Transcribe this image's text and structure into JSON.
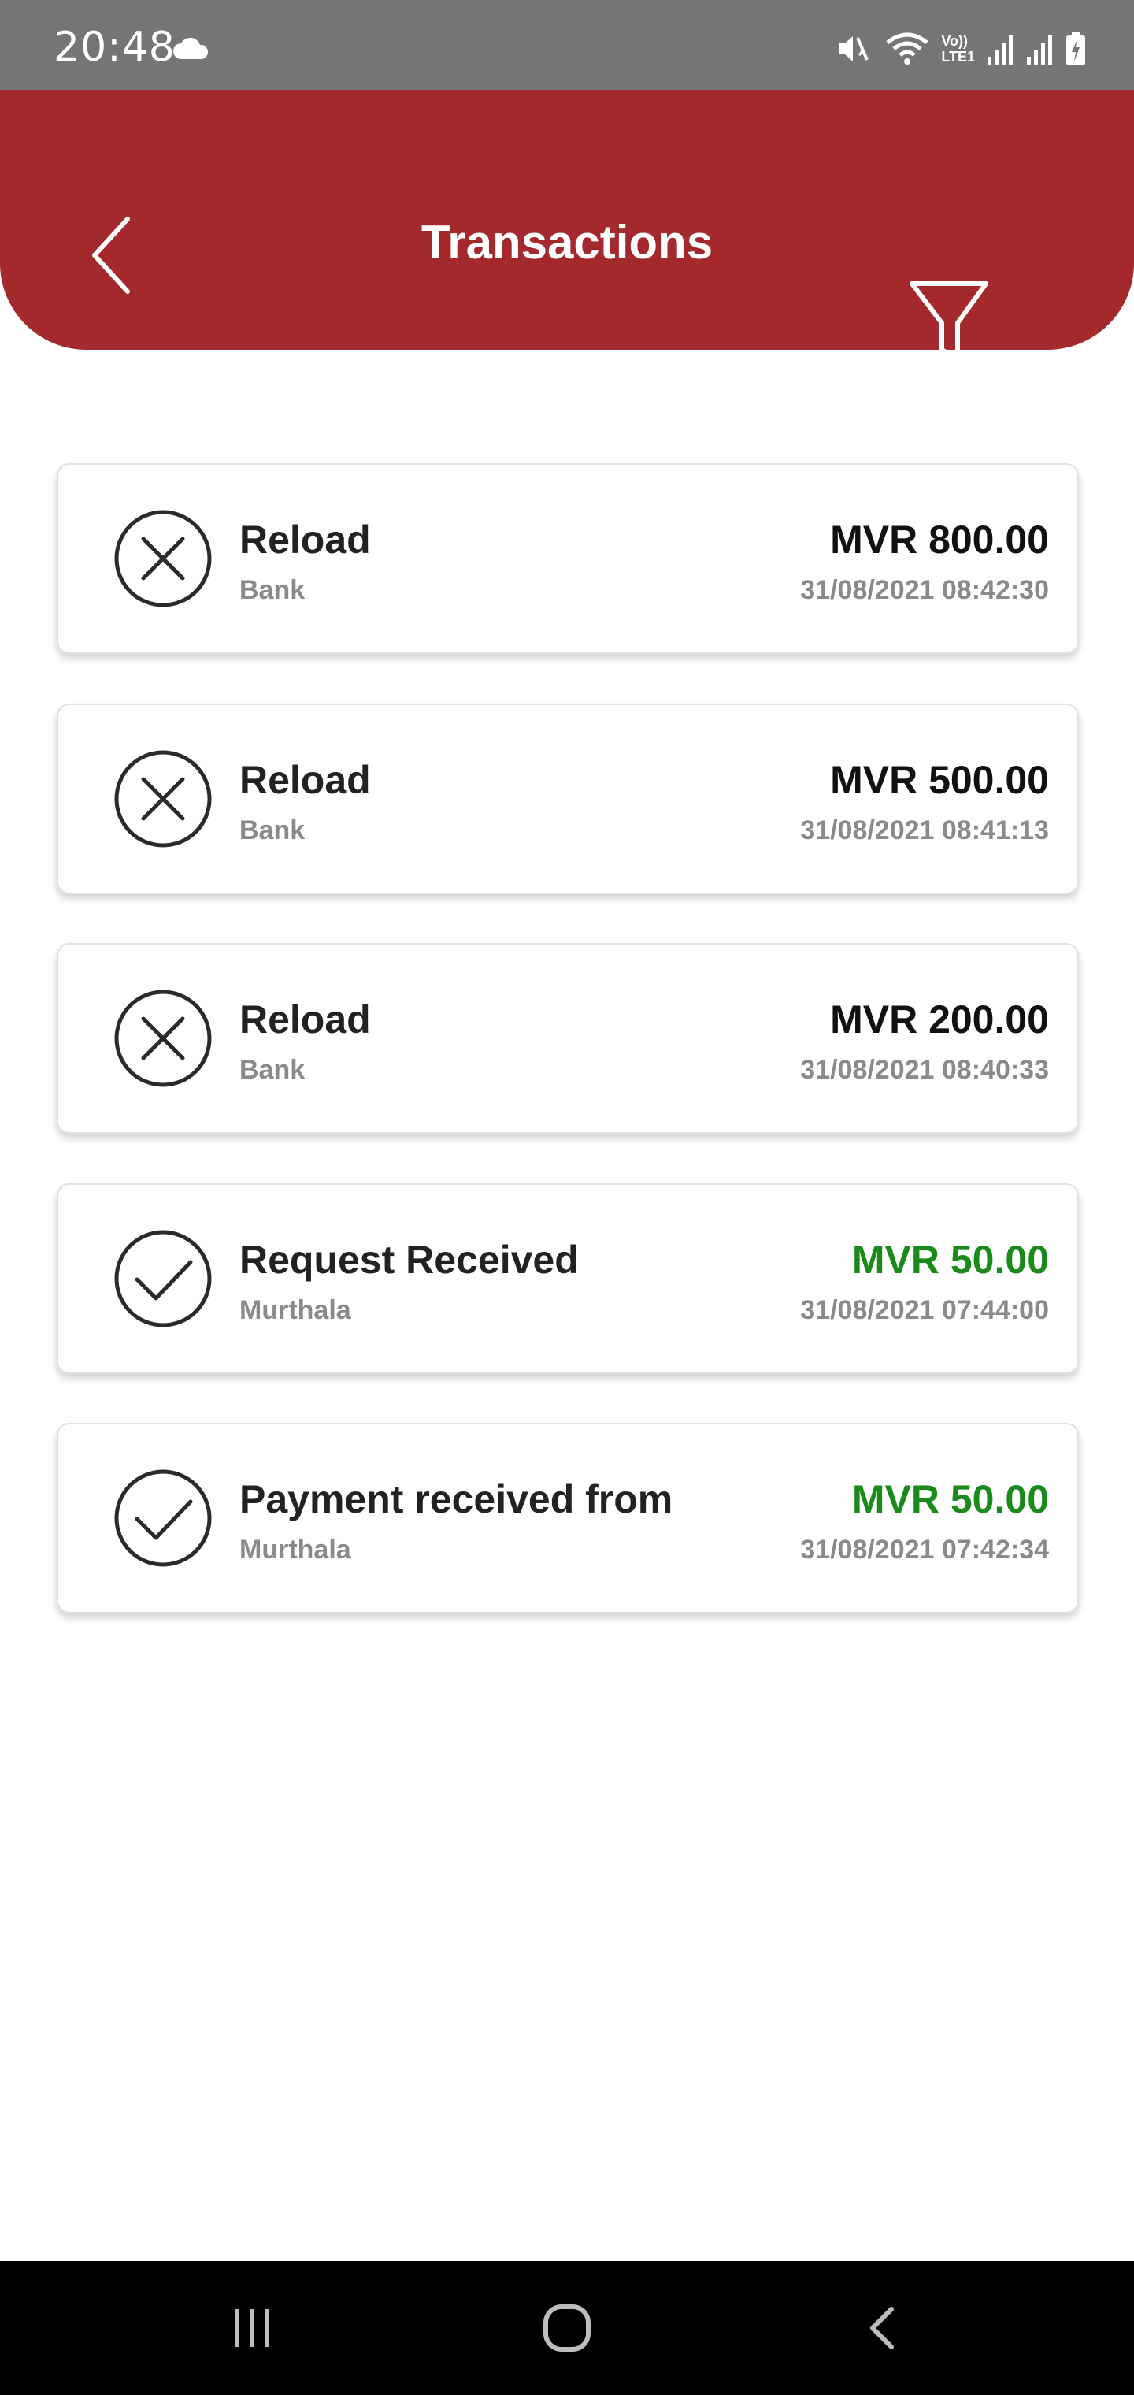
{
  "status_bar": {
    "time": "20:48",
    "icons": [
      "cloud-icon",
      "mute-icon",
      "wifi-icon",
      "volte-icon",
      "signal-icon",
      "signal-icon",
      "battery-icon"
    ],
    "volte_label_top": "Vo))",
    "volte_label_bottom": "LTE1"
  },
  "header": {
    "title": "Transactions",
    "back_icon": "back-arrow-icon",
    "filter_icon": "filter-icon",
    "background_color": "#a3292c"
  },
  "transactions": [
    {
      "status": "failed",
      "status_icon": "failed-icon",
      "title": "Reload",
      "subtitle": "Bank",
      "amount": "MVR 800.00",
      "datetime": "31/08/2021 08:42:30",
      "amount_color": "#111111"
    },
    {
      "status": "failed",
      "status_icon": "failed-icon",
      "title": "Reload",
      "subtitle": "Bank",
      "amount": "MVR 500.00",
      "datetime": "31/08/2021 08:41:13",
      "amount_color": "#111111"
    },
    {
      "status": "failed",
      "status_icon": "failed-icon",
      "title": "Reload",
      "subtitle": "Bank",
      "amount": "MVR 200.00",
      "datetime": "31/08/2021 08:40:33",
      "amount_color": "#111111"
    },
    {
      "status": "success",
      "status_icon": "success-icon",
      "title": "Request Received",
      "subtitle": "Murthala",
      "amount": "MVR 50.00",
      "datetime": "31/08/2021 07:44:00",
      "amount_color": "#1a8a1a"
    },
    {
      "status": "success",
      "status_icon": "success-icon",
      "title": "Payment received from",
      "subtitle": "Murthala",
      "amount": "MVR 50.00",
      "datetime": "31/08/2021 07:42:34",
      "amount_color": "#1a8a1a"
    }
  ],
  "nav_bar": {
    "buttons": [
      "recent-apps-icon",
      "home-icon",
      "back-icon"
    ]
  }
}
